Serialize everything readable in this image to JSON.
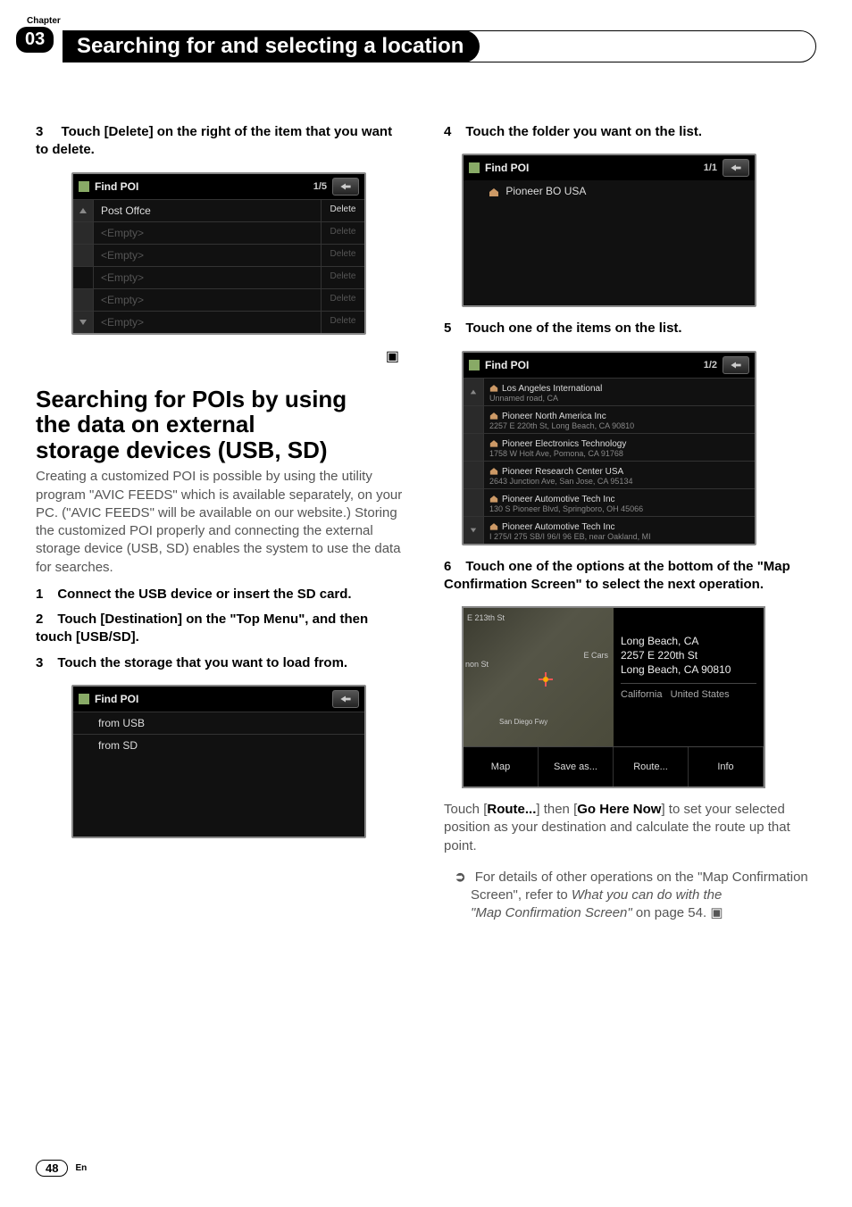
{
  "chapter_label": "Chapter",
  "chapter_number": "03",
  "header_title": "Searching for and selecting a location",
  "left": {
    "step3_num": "3",
    "step3_text": "Touch [Delete] on the right of the item that you want to delete.",
    "fig1": {
      "title": "Find POI",
      "pager": "1/5",
      "row1_label": "Post Offce",
      "row1_btn": "Delete",
      "empty_label": "<Empty>",
      "empty_btn": "Delete"
    },
    "h2_line1": "Searching for POIs by using",
    "h2_line2": "the data on external",
    "h2_line3": "storage devices (USB, SD)",
    "intro": "Creating a customized POI is possible by using the utility program \"AVIC FEEDS\" which is available separately, on your PC. (\"AVIC FEEDS\" will be available on our website.) Storing the customized POI properly and connecting the external storage device (USB, SD) enables the system to use the data for searches.",
    "s1_num": "1",
    "s1_text": "Connect the USB device or insert the SD card.",
    "s2_num": "2",
    "s2_text": "Touch [Destination] on the \"Top Menu\", and then touch [USB/SD].",
    "s3_num": "3",
    "s3_text": "Touch the storage that you want to load from.",
    "fig2": {
      "title": "Find POI",
      "row1": "from USB",
      "row2": "from SD"
    }
  },
  "right": {
    "s4_num": "4",
    "s4_text": "Touch the folder you want on the list.",
    "fig3": {
      "title": "Find POI",
      "pager": "1/1",
      "row1": "Pioneer BO USA"
    },
    "s5_num": "5",
    "s5_text": "Touch one of the items on the list.",
    "fig4": {
      "title": "Find POI",
      "pager": "1/2",
      "rows": [
        {
          "t": "Los Angeles International",
          "s": "Unnamed road, CA"
        },
        {
          "t": "Pioneer North America Inc",
          "s": "2257 E 220th St, Long Beach, CA 90810"
        },
        {
          "t": "Pioneer Electronics Technology",
          "s": "1758 W Holt Ave, Pomona, CA 91768"
        },
        {
          "t": "Pioneer Research Center USA",
          "s": "2643 Junction Ave, San Jose, CA 95134"
        },
        {
          "t": "Pioneer Automotive Tech Inc",
          "s": "130 S Pioneer Blvd, Springboro, OH 45066"
        },
        {
          "t": "Pioneer Automotive Tech Inc",
          "s": "I 275/I 275 SB/I 96/I 96 EB, near Oakland, MI"
        }
      ]
    },
    "s6_num": "6",
    "s6_text": "Touch one of the options at the bottom of the \"Map Confirmation Screen\" to select the next operation.",
    "mapfig": {
      "street1": "E 213th St",
      "street2": "non St",
      "carson": "E Cars",
      "sandiego": "San Diego Fwy",
      "info_line1": "Long Beach, CA",
      "info_line2": "2257 E 220th St",
      "info_line3": "Long Beach, CA 90810",
      "info_state": "California",
      "info_country": "United States",
      "btn1": "Map",
      "btn2": "Save as...",
      "btn3": "Route...",
      "btn4": "Info"
    },
    "after_prefix": "Touch [",
    "after_route": "Route...",
    "after_mid": "] then [",
    "after_go": "Go Here Now",
    "after_suffix": "] to set your selected position as your destination and calculate the route up that point.",
    "ref_arrow": "➲",
    "ref_text1": "For details of other operations on the \"Map Confirmation Screen\", refer to ",
    "ref_italic1": "What you can do with the",
    "ref_italic2": "\"Map Confirmation Screen\"",
    "ref_text2": " on page 54."
  },
  "end_glyph": "▣",
  "page_number": "48",
  "page_lang": "En"
}
